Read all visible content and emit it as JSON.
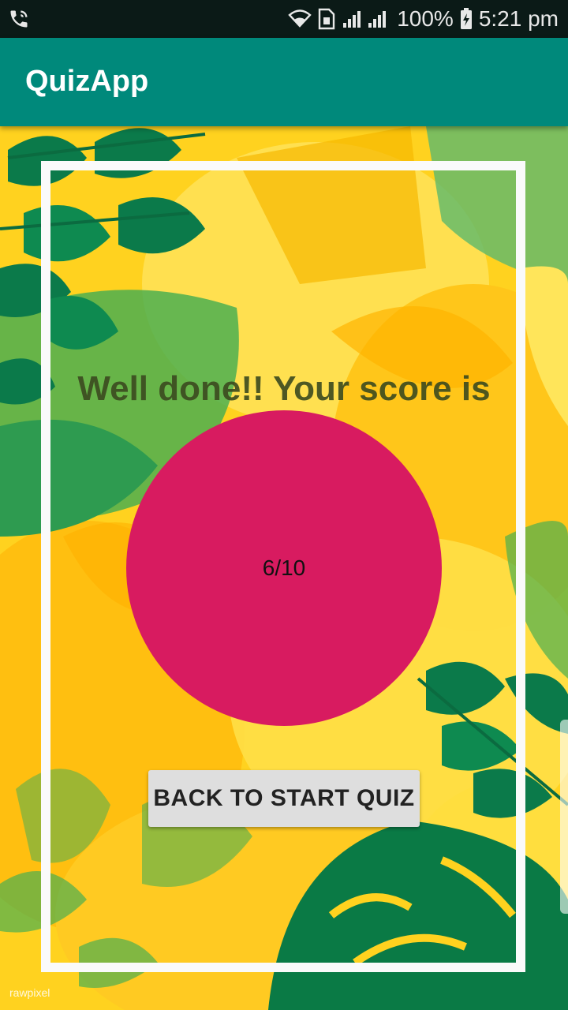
{
  "status_bar": {
    "battery": "100%",
    "time": "5:21 pm",
    "icons": [
      "phone-call-icon",
      "wifi-icon",
      "sim-icon",
      "signal-icon",
      "battery-icon"
    ]
  },
  "app_bar": {
    "title": "QuizApp"
  },
  "result": {
    "headline": "Well done!! Your score is",
    "score": "6/10"
  },
  "actions": {
    "back_button": "BACK TO START QUIZ"
  },
  "watermark": "rawpixel",
  "colors": {
    "app_bar": "#00897b",
    "status_bar": "#0b1a17",
    "score_circle": "#d81b60",
    "button": "#dedede",
    "background": "#ffd11a"
  }
}
